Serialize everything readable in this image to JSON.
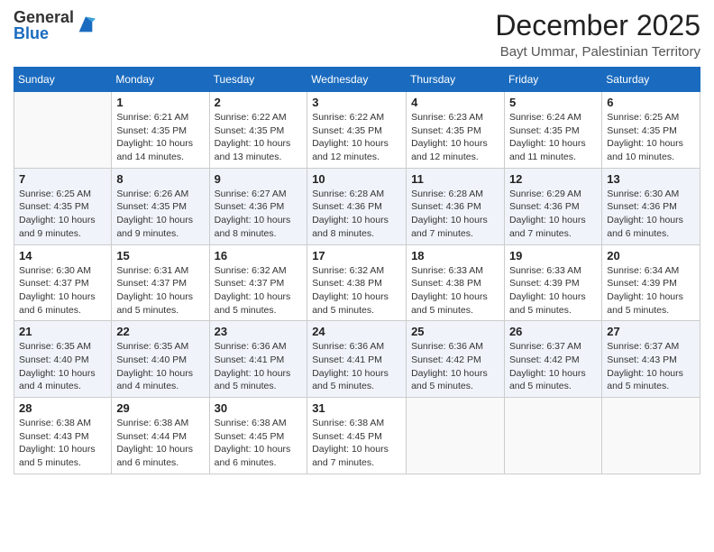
{
  "logo": {
    "general": "General",
    "blue": "Blue"
  },
  "header": {
    "month": "December 2025",
    "location": "Bayt Ummar, Palestinian Territory"
  },
  "days_of_week": [
    "Sunday",
    "Monday",
    "Tuesday",
    "Wednesday",
    "Thursday",
    "Friday",
    "Saturday"
  ],
  "weeks": [
    [
      {
        "day": "",
        "info": ""
      },
      {
        "day": "1",
        "info": "Sunrise: 6:21 AM\nSunset: 4:35 PM\nDaylight: 10 hours and 14 minutes."
      },
      {
        "day": "2",
        "info": "Sunrise: 6:22 AM\nSunset: 4:35 PM\nDaylight: 10 hours and 13 minutes."
      },
      {
        "day": "3",
        "info": "Sunrise: 6:22 AM\nSunset: 4:35 PM\nDaylight: 10 hours and 12 minutes."
      },
      {
        "day": "4",
        "info": "Sunrise: 6:23 AM\nSunset: 4:35 PM\nDaylight: 10 hours and 12 minutes."
      },
      {
        "day": "5",
        "info": "Sunrise: 6:24 AM\nSunset: 4:35 PM\nDaylight: 10 hours and 11 minutes."
      },
      {
        "day": "6",
        "info": "Sunrise: 6:25 AM\nSunset: 4:35 PM\nDaylight: 10 hours and 10 minutes."
      }
    ],
    [
      {
        "day": "7",
        "info": "Sunrise: 6:25 AM\nSunset: 4:35 PM\nDaylight: 10 hours and 9 minutes."
      },
      {
        "day": "8",
        "info": "Sunrise: 6:26 AM\nSunset: 4:35 PM\nDaylight: 10 hours and 9 minutes."
      },
      {
        "day": "9",
        "info": "Sunrise: 6:27 AM\nSunset: 4:36 PM\nDaylight: 10 hours and 8 minutes."
      },
      {
        "day": "10",
        "info": "Sunrise: 6:28 AM\nSunset: 4:36 PM\nDaylight: 10 hours and 8 minutes."
      },
      {
        "day": "11",
        "info": "Sunrise: 6:28 AM\nSunset: 4:36 PM\nDaylight: 10 hours and 7 minutes."
      },
      {
        "day": "12",
        "info": "Sunrise: 6:29 AM\nSunset: 4:36 PM\nDaylight: 10 hours and 7 minutes."
      },
      {
        "day": "13",
        "info": "Sunrise: 6:30 AM\nSunset: 4:36 PM\nDaylight: 10 hours and 6 minutes."
      }
    ],
    [
      {
        "day": "14",
        "info": "Sunrise: 6:30 AM\nSunset: 4:37 PM\nDaylight: 10 hours and 6 minutes."
      },
      {
        "day": "15",
        "info": "Sunrise: 6:31 AM\nSunset: 4:37 PM\nDaylight: 10 hours and 5 minutes."
      },
      {
        "day": "16",
        "info": "Sunrise: 6:32 AM\nSunset: 4:37 PM\nDaylight: 10 hours and 5 minutes."
      },
      {
        "day": "17",
        "info": "Sunrise: 6:32 AM\nSunset: 4:38 PM\nDaylight: 10 hours and 5 minutes."
      },
      {
        "day": "18",
        "info": "Sunrise: 6:33 AM\nSunset: 4:38 PM\nDaylight: 10 hours and 5 minutes."
      },
      {
        "day": "19",
        "info": "Sunrise: 6:33 AM\nSunset: 4:39 PM\nDaylight: 10 hours and 5 minutes."
      },
      {
        "day": "20",
        "info": "Sunrise: 6:34 AM\nSunset: 4:39 PM\nDaylight: 10 hours and 5 minutes."
      }
    ],
    [
      {
        "day": "21",
        "info": "Sunrise: 6:35 AM\nSunset: 4:40 PM\nDaylight: 10 hours and 4 minutes."
      },
      {
        "day": "22",
        "info": "Sunrise: 6:35 AM\nSunset: 4:40 PM\nDaylight: 10 hours and 4 minutes."
      },
      {
        "day": "23",
        "info": "Sunrise: 6:36 AM\nSunset: 4:41 PM\nDaylight: 10 hours and 5 minutes."
      },
      {
        "day": "24",
        "info": "Sunrise: 6:36 AM\nSunset: 4:41 PM\nDaylight: 10 hours and 5 minutes."
      },
      {
        "day": "25",
        "info": "Sunrise: 6:36 AM\nSunset: 4:42 PM\nDaylight: 10 hours and 5 minutes."
      },
      {
        "day": "26",
        "info": "Sunrise: 6:37 AM\nSunset: 4:42 PM\nDaylight: 10 hours and 5 minutes."
      },
      {
        "day": "27",
        "info": "Sunrise: 6:37 AM\nSunset: 4:43 PM\nDaylight: 10 hours and 5 minutes."
      }
    ],
    [
      {
        "day": "28",
        "info": "Sunrise: 6:38 AM\nSunset: 4:43 PM\nDaylight: 10 hours and 5 minutes."
      },
      {
        "day": "29",
        "info": "Sunrise: 6:38 AM\nSunset: 4:44 PM\nDaylight: 10 hours and 6 minutes."
      },
      {
        "day": "30",
        "info": "Sunrise: 6:38 AM\nSunset: 4:45 PM\nDaylight: 10 hours and 6 minutes."
      },
      {
        "day": "31",
        "info": "Sunrise: 6:38 AM\nSunset: 4:45 PM\nDaylight: 10 hours and 7 minutes."
      },
      {
        "day": "",
        "info": ""
      },
      {
        "day": "",
        "info": ""
      },
      {
        "day": "",
        "info": ""
      }
    ]
  ]
}
